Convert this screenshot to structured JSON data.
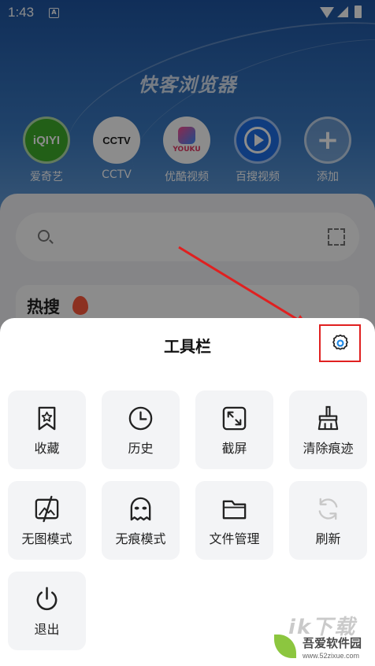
{
  "status_bar": {
    "time": "1:43",
    "notification_glyph": "A"
  },
  "app": {
    "title": "快客浏览器"
  },
  "shortcuts": [
    {
      "label": "爱奇艺",
      "logo_text": "iQIYI",
      "icon": "iqiyi-logo"
    },
    {
      "label": "CCTV",
      "logo_text": "CCTV",
      "icon": "cctv-logo"
    },
    {
      "label": "优酷视频",
      "logo_text": "YOUKU",
      "icon": "youku-logo"
    },
    {
      "label": "百搜视频",
      "logo_text": "",
      "icon": "play-icon"
    },
    {
      "label": "添加",
      "logo_text": "+",
      "icon": "plus-icon"
    }
  ],
  "search": {
    "placeholder": ""
  },
  "hot": {
    "label": "热搜"
  },
  "toolbar": {
    "title": "工具栏",
    "items": [
      {
        "label": "收藏",
        "icon": "bookmark-star-icon"
      },
      {
        "label": "历史",
        "icon": "clock-icon"
      },
      {
        "label": "截屏",
        "icon": "screenshot-icon"
      },
      {
        "label": "清除痕迹",
        "icon": "broom-icon"
      },
      {
        "label": "无图模式",
        "icon": "no-image-icon"
      },
      {
        "label": "无痕模式",
        "icon": "ghost-icon"
      },
      {
        "label": "文件管理",
        "icon": "folder-icon"
      },
      {
        "label": "刷新",
        "icon": "refresh-icon"
      },
      {
        "label": "退出",
        "icon": "power-icon"
      }
    ]
  },
  "watermark": {
    "logo": "ik下载",
    "name": "吾爱软件园",
    "url": "www.52zixue.com"
  },
  "colors": {
    "highlight": "#e02020",
    "accent": "#1e88e5",
    "sheet_bg": "#ffffff",
    "tile_bg": "#f3f4f6"
  }
}
